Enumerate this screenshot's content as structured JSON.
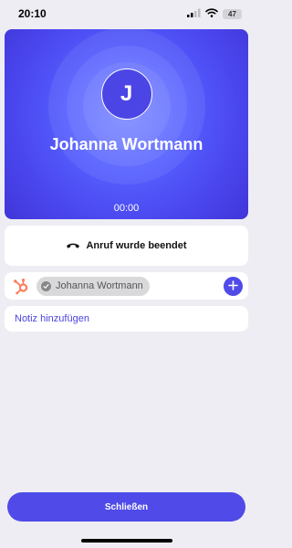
{
  "status_bar": {
    "time": "20:10",
    "battery": "47",
    "signal_icon": "cellular-signal-icon",
    "wifi_icon": "wifi-icon",
    "battery_icon": "battery-icon"
  },
  "call": {
    "avatar_initial": "J",
    "caller_name": "Johanna Wortmann",
    "timer": "00:00",
    "background_color": "#5058f5"
  },
  "call_status": {
    "icon": "phone-hangup-icon",
    "text": "Anruf wurde beendet"
  },
  "crm": {
    "integration_icon": "hubspot-icon",
    "contact_check_icon": "check-circle-icon",
    "contact_name": "Johanna Wortmann",
    "add_icon": "plus-icon"
  },
  "note": {
    "label": "Notiz hinzufügen"
  },
  "footer": {
    "close_label": "Schließen"
  },
  "colors": {
    "accent": "#4f4ae8",
    "hubspot": "#ff7a59",
    "background": "#eeedf3"
  }
}
